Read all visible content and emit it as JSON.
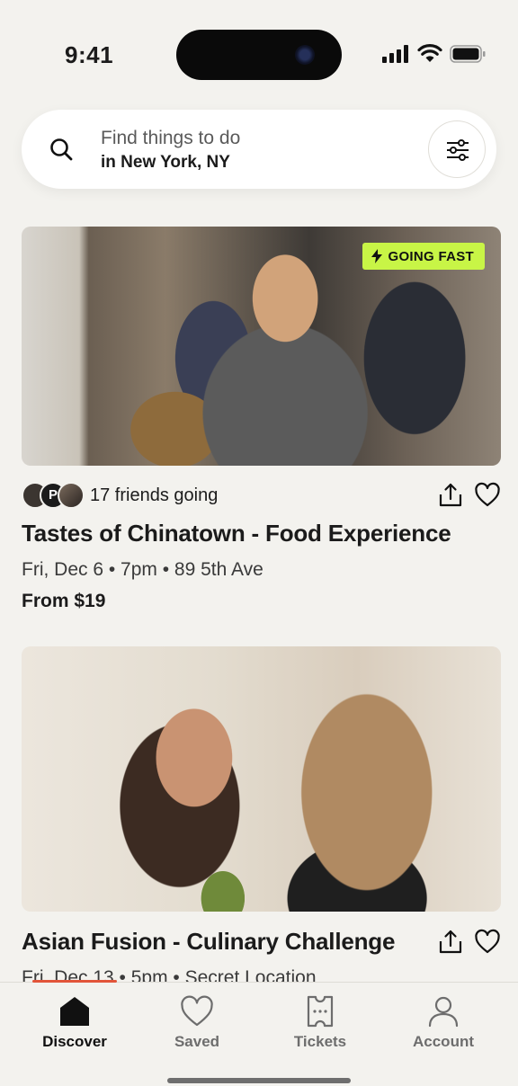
{
  "status": {
    "time": "9:41"
  },
  "search": {
    "placeholder": "Find things to do",
    "location": "in New York, NY"
  },
  "events": [
    {
      "badge": "GOING FAST",
      "friends_count_text": "17 friends going",
      "avatar_initial": "P",
      "title": "Tastes of Chinatown - Food Experience",
      "meta": "Fri, Dec 6 • 7pm • 89 5th Ave",
      "price": "From $19"
    },
    {
      "title": "Asian Fusion - Culinary Challenge",
      "meta": "Fri, Dec 13 • 5pm • Secret Location"
    }
  ],
  "tabs": [
    {
      "label": "Discover",
      "icon": "home-icon",
      "active": true
    },
    {
      "label": "Saved",
      "icon": "heart-icon",
      "active": false
    },
    {
      "label": "Tickets",
      "icon": "ticket-icon",
      "active": false
    },
    {
      "label": "Account",
      "icon": "person-icon",
      "active": false
    }
  ],
  "colors": {
    "badge": "#c8f546",
    "background": "#f3f2ee",
    "accent_underline": "#e2553a"
  }
}
